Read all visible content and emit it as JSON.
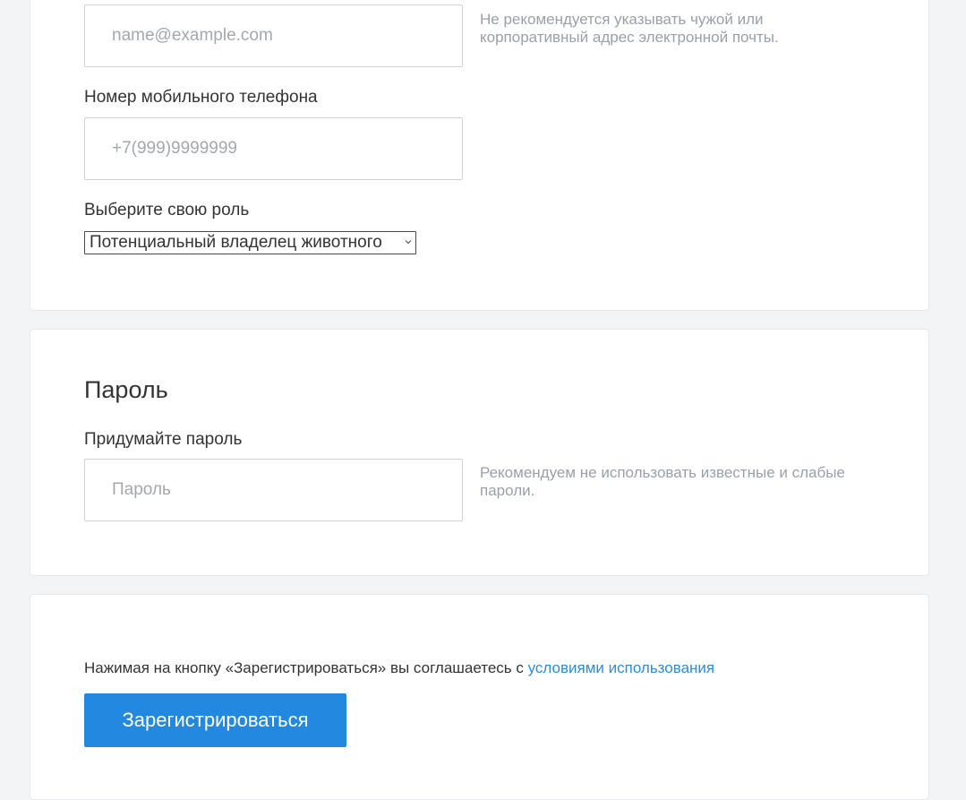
{
  "contacts": {
    "email": {
      "value": "",
      "placeholder": "name@example.com",
      "hint": "Не рекомендуется указывать чужой или корпоративный адрес электронной почты."
    },
    "phone": {
      "label": "Номер мобильного телефона",
      "value": "",
      "placeholder": "+7(999)9999999"
    },
    "role": {
      "label": "Выберите свою роль",
      "selected": "Потенциальный владелец животного"
    }
  },
  "password": {
    "title": "Пароль",
    "label": "Придумайте пароль",
    "value": "",
    "placeholder": "Пароль",
    "hint": "Рекомендуем не использовать известные и слабые пароли."
  },
  "submit": {
    "agreement_text": "Нажимая на кнопку «Зарегистрироваться» вы соглашаетесь с",
    "terms_link": "условиями использования",
    "button_label": "Зарегистрироваться"
  },
  "colors": {
    "accent": "#2389e0",
    "link": "#2f8bd8",
    "page_background": "#f3f4f6"
  }
}
